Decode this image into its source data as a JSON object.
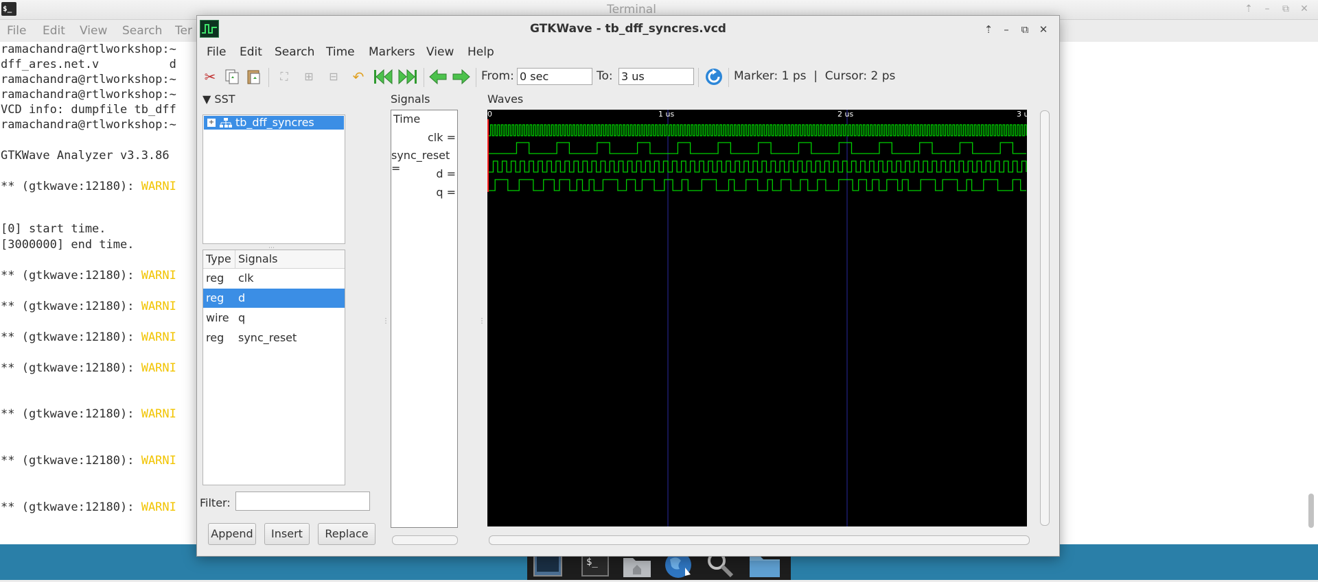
{
  "terminal": {
    "title": "Terminal",
    "menu": [
      "File",
      "Edit",
      "View",
      "Search",
      "Ter"
    ],
    "lines": [
      {
        "text": "ramachandra@rtlworkshop:~",
        "warn": ""
      },
      {
        "text": "dff_ares.net.v          d",
        "warn": ""
      },
      {
        "text": "ramachandra@rtlworkshop:~",
        "warn": ""
      },
      {
        "text": "ramachandra@rtlworkshop:~",
        "warn": ""
      },
      {
        "text": "VCD info: dumpfile tb_dff",
        "warn": ""
      },
      {
        "text": "ramachandra@rtlworkshop:~",
        "warn": ""
      },
      {
        "text": "",
        "warn": ""
      },
      {
        "text": "GTKWave Analyzer v3.3.86",
        "warn": ""
      },
      {
        "text": "** (gtkwave:12180): ",
        "warn": "WARNI"
      },
      {
        "text": "[0] start time.",
        "warn": ""
      },
      {
        "text": "[3000000] end time.",
        "warn": ""
      },
      {
        "text": "** (gtkwave:12180): ",
        "warn": "WARNI"
      },
      {
        "text": "** (gtkwave:12180): ",
        "warn": "WARNI"
      },
      {
        "text": "** (gtkwave:12180): ",
        "warn": "WARNI"
      },
      {
        "text": "** (gtkwave:12180): ",
        "warn": "WARNI"
      },
      {
        "text": "** (gtkwave:12180): ",
        "warn": "WARNI"
      },
      {
        "text": "** (gtkwave:12180): ",
        "warn": "WARNI"
      },
      {
        "text": "** (gtkwave:12180): ",
        "warn": "WARNI"
      }
    ]
  },
  "gtkwave": {
    "title": "GTKWave - tb_dff_syncres.vcd",
    "menu": [
      "File",
      "Edit",
      "Search",
      "Time",
      "Markers",
      "View",
      "Help"
    ],
    "toolbar": {
      "from_label": "From:",
      "from_value": "0 sec",
      "to_label": "To:",
      "to_value": "3 us",
      "marker_text": "Marker: 1 ps  |  Cursor: 2 ps"
    },
    "sst": {
      "header": "SST",
      "tree_item": "tb_dff_syncres",
      "col_type": "Type",
      "col_signals": "Signals",
      "rows": [
        {
          "type": "reg",
          "name": "clk",
          "selected": false
        },
        {
          "type": "reg",
          "name": "d",
          "selected": true
        },
        {
          "type": "wire",
          "name": "q",
          "selected": false
        },
        {
          "type": "reg",
          "name": "sync_reset",
          "selected": false
        }
      ],
      "filter_label": "Filter:",
      "filter_value": "",
      "buttons": [
        "Append",
        "Insert",
        "Replace"
      ]
    },
    "signals_pane": {
      "header": "Signals",
      "time_label": "Time",
      "signals": [
        "clk =",
        "sync_reset =",
        "d =",
        "q ="
      ]
    },
    "waves_pane": {
      "header": "Waves",
      "time_unit": "us",
      "range": [
        0,
        3
      ],
      "ticks": [
        {
          "t": 0,
          "label": "0"
        },
        {
          "t": 1,
          "label": "1 us"
        },
        {
          "t": 2,
          "label": "2 us"
        },
        {
          "t": 3,
          "label": "3 u"
        }
      ],
      "wave_color": "#00d000",
      "cursor_color": "#ff2020",
      "grid_color": "#2a2aa0",
      "traces": [
        {
          "name": "clk",
          "period_us": 0.02
        },
        {
          "name": "sync_reset",
          "period_us": 0.225
        },
        {
          "name": "d",
          "period_us": 0.05
        },
        {
          "name": "q",
          "period_us": 0.05
        }
      ]
    }
  },
  "dock": {
    "items": [
      "screen-icon",
      "terminal-icon",
      "home-folder-icon",
      "browser-icon",
      "search-icon",
      "folder-icon"
    ]
  }
}
